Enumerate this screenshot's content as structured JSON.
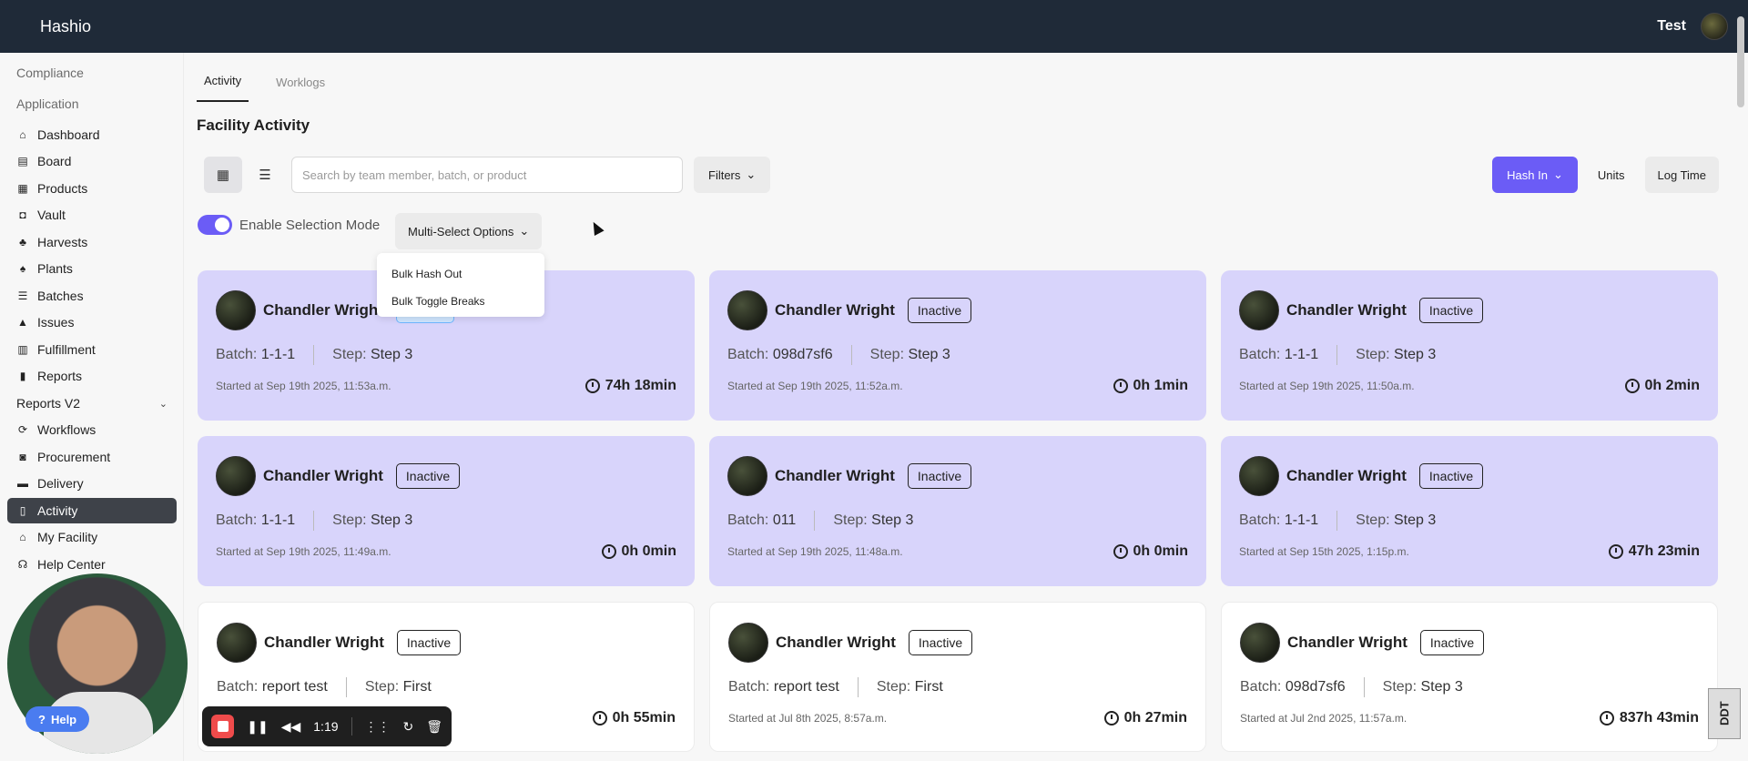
{
  "app": {
    "brand": "Hashio",
    "user": "Test"
  },
  "sidebar": {
    "sections": [
      "Compliance",
      "Application"
    ],
    "items": [
      {
        "label": "Dashboard",
        "icon": "home-icon"
      },
      {
        "label": "Board",
        "icon": "board-icon"
      },
      {
        "label": "Products",
        "icon": "products-icon"
      },
      {
        "label": "Vault",
        "icon": "vault-icon"
      },
      {
        "label": "Harvests",
        "icon": "harvest-icon"
      },
      {
        "label": "Plants",
        "icon": "plant-icon"
      },
      {
        "label": "Batches",
        "icon": "batch-icon"
      },
      {
        "label": "Issues",
        "icon": "warning-icon"
      },
      {
        "label": "Fulfillment",
        "icon": "fulfillment-icon"
      },
      {
        "label": "Reports",
        "icon": "bar-chart-icon"
      },
      {
        "label": "Reports V2",
        "icon": ""
      },
      {
        "label": "Workflows",
        "icon": "workflow-icon"
      },
      {
        "label": "Procurement",
        "icon": "bag-icon"
      },
      {
        "label": "Delivery",
        "icon": "truck-icon"
      },
      {
        "label": "Activity",
        "icon": "activity-icon"
      },
      {
        "label": "My Facility",
        "icon": "facility-icon"
      },
      {
        "label": "Help Center",
        "icon": "headset-icon"
      }
    ]
  },
  "tabs": [
    "Activity",
    "Worklogs"
  ],
  "page_title": "Facility Activity",
  "search": {
    "placeholder": "Search by team member, batch, or product",
    "value": ""
  },
  "filters_label": "Filters",
  "toolbar_right": {
    "hash_in": "Hash In",
    "units": "Units",
    "log_time": "Log Time"
  },
  "selection": {
    "toggle_label": "Enable Selection Mode",
    "toggle_on": true,
    "multi_select": "Multi-Select Options"
  },
  "dropdown": [
    "Bulk Hash Out",
    "Bulk Toggle Breaks"
  ],
  "cards": [
    {
      "name": "Chandler Wright",
      "badge": "",
      "batch_label": "Batch:",
      "batch": "1-1-1",
      "step_label": "Step:",
      "step": "Step 3",
      "started": "Started at Sep 19th 2025, 11:53a.m.",
      "duration": "74h 18min",
      "style": "purple"
    },
    {
      "name": "Chandler Wright",
      "badge": "Inactive",
      "batch_label": "Batch:",
      "batch": "098d7sf6",
      "step_label": "Step:",
      "step": "Step 3",
      "started": "Started at Sep 19th 2025, 11:52a.m.",
      "duration": "0h 1min",
      "style": "purple"
    },
    {
      "name": "Chandler Wright",
      "badge": "Inactive",
      "batch_label": "Batch:",
      "batch": "1-1-1",
      "step_label": "Step:",
      "step": "Step 3",
      "started": "Started at Sep 19th 2025, 11:50a.m.",
      "duration": "0h 2min",
      "style": "purple"
    },
    {
      "name": "Chandler Wright",
      "badge": "Inactive",
      "batch_label": "Batch:",
      "batch": "1-1-1",
      "step_label": "Step:",
      "step": "Step 3",
      "started": "Started at Sep 19th 2025, 11:49a.m.",
      "duration": "0h 0min",
      "style": "purple"
    },
    {
      "name": "Chandler Wright",
      "badge": "Inactive",
      "batch_label": "Batch:",
      "batch": "011",
      "step_label": "Step:",
      "step": "Step 3",
      "started": "Started at Sep 19th 2025, 11:48a.m.",
      "duration": "0h 0min",
      "style": "purple"
    },
    {
      "name": "Chandler Wright",
      "badge": "Inactive",
      "batch_label": "Batch:",
      "batch": "1-1-1",
      "step_label": "Step:",
      "step": "Step 3",
      "started": "Started at Sep 15th 2025, 1:15p.m.",
      "duration": "47h 23min",
      "style": "purple"
    },
    {
      "name": "Chandler Wright",
      "badge": "Inactive",
      "batch_label": "Batch:",
      "batch": "report test",
      "step_label": "Step:",
      "step": "First",
      "started": "",
      "duration": "0h 55min",
      "style": "white"
    },
    {
      "name": "Chandler Wright",
      "badge": "Inactive",
      "batch_label": "Batch:",
      "batch": "report test",
      "step_label": "Step:",
      "step": "First",
      "started": "Started at Jul 8th 2025, 8:57a.m.",
      "duration": "0h 27min",
      "style": "white"
    },
    {
      "name": "Chandler Wright",
      "badge": "Inactive",
      "batch_label": "Batch:",
      "batch": "098d7sf6",
      "step_label": "Step:",
      "step": "Step 3",
      "started": "Started at Jul 2nd 2025, 11:57a.m.",
      "duration": "837h 43min",
      "style": "white"
    }
  ],
  "recorder": {
    "help": "Help",
    "time": "1:19"
  },
  "watermark": "DDT",
  "colors": {
    "accent": "#6b5cf6",
    "topbar": "#1f2a38",
    "card_active": "#d8d4fb"
  }
}
